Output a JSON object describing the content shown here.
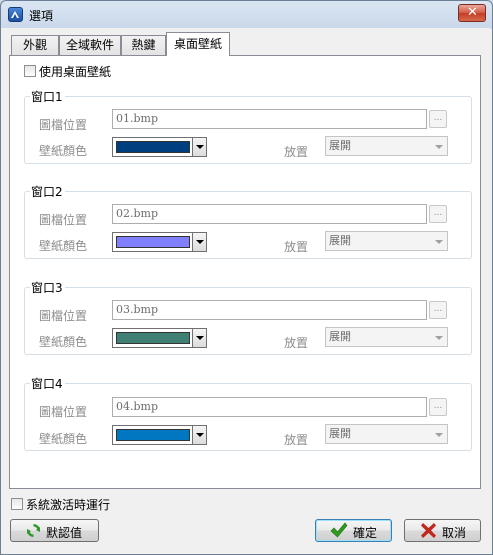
{
  "window": {
    "title": "選項",
    "close_glyph": "✕"
  },
  "tabs": [
    {
      "label": "外觀",
      "active": false
    },
    {
      "label": "全域軟件",
      "active": false
    },
    {
      "label": "熱鍵",
      "active": false
    },
    {
      "label": "桌面壁紙",
      "active": true
    }
  ],
  "use_wallpaper": {
    "label": "使用桌面壁紙",
    "checked": false
  },
  "groups": [
    {
      "title": "窗口1",
      "image_label": "圖檔位置",
      "image_value": "01.bmp",
      "browse_label": "...",
      "color_label": "壁紙顏色",
      "color": "#003f7f",
      "place_label": "放置",
      "place_value": "展開"
    },
    {
      "title": "窗口2",
      "image_label": "圖檔位置",
      "image_value": "02.bmp",
      "browse_label": "...",
      "color_label": "壁紙顏色",
      "color": "#8080ff",
      "place_label": "放置",
      "place_value": "展開"
    },
    {
      "title": "窗口3",
      "image_label": "圖檔位置",
      "image_value": "03.bmp",
      "browse_label": "...",
      "color_label": "壁紙顏色",
      "color": "#3f7f74",
      "place_label": "放置",
      "place_value": "展開"
    },
    {
      "title": "窗口4",
      "image_label": "圖檔位置",
      "image_value": "04.bmp",
      "browse_label": "...",
      "color_label": "壁紙顏色",
      "color": "#0077c0",
      "place_label": "放置",
      "place_value": "展開"
    }
  ],
  "startup": {
    "label": "系統激活時運行",
    "checked": false
  },
  "buttons": {
    "defaults": "默認值",
    "ok": "確定",
    "cancel": "取消"
  },
  "colors": {
    "defaults_icon": "#2e9a2e",
    "ok_icon": "#2f9b1f",
    "cancel_icon": "#c0281e"
  }
}
